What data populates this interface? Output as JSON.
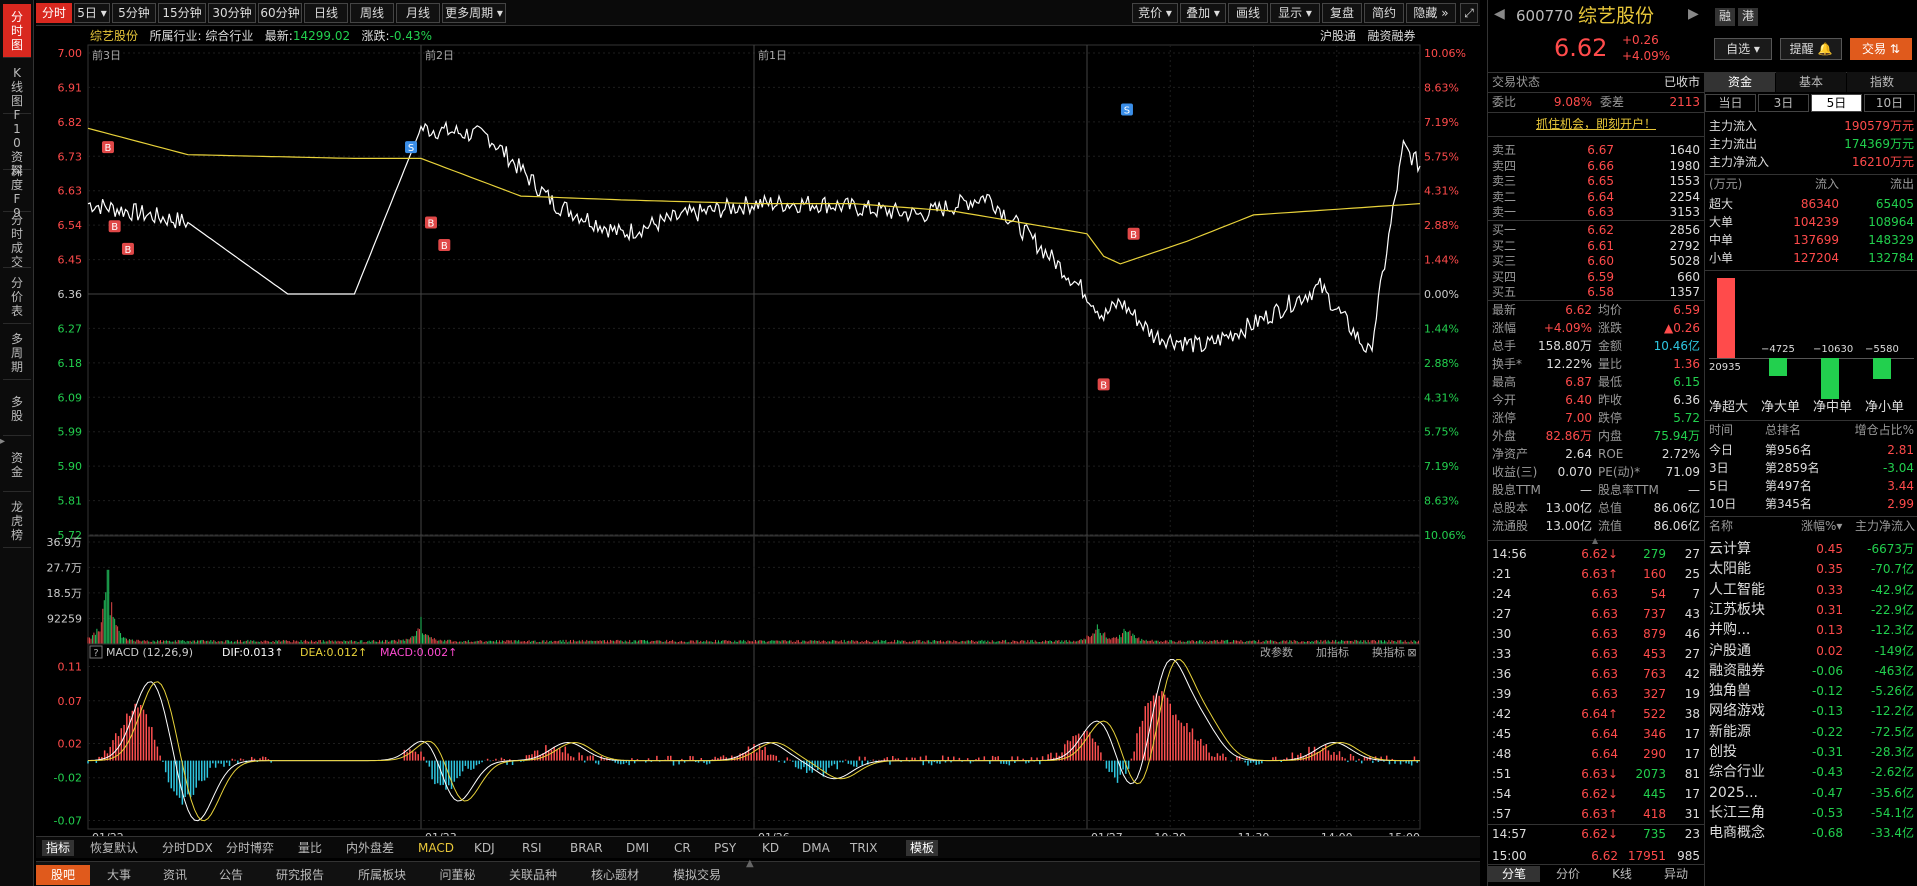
{
  "leftbar": [
    "分时图",
    "K线图",
    "F10资料",
    "深度F9",
    "分时成交",
    "分价表",
    "多周期",
    "多股",
    "资金",
    "龙虎榜"
  ],
  "topbar": {
    "periods": [
      "分时",
      "5日",
      "5分钟",
      "15分钟",
      "30分钟",
      "60分钟",
      "日线",
      "周线",
      "月线",
      "更多周期"
    ],
    "tools": [
      "竞价",
      "叠加",
      "画线",
      "显示",
      "复盘",
      "简约",
      "隐藏"
    ]
  },
  "infobar": {
    "name": "综艺股份",
    "industry": "所属行业: 综合行业",
    "latest_label": "最新:",
    "latest": "14299.02",
    "change_label": "涨跌:",
    "change": "-0.43%",
    "right": [
      "沪股通",
      "融资融券"
    ]
  },
  "chart_data": [
    {
      "type": "line",
      "title": "",
      "day_labels": [
        "前3日",
        "前2日",
        "前1日",
        ""
      ],
      "x_labels": [
        "01/22",
        "01/23",
        "01/26",
        "01/27",
        "10:30",
        "11:30",
        "14:00",
        "15:00"
      ],
      "ylim": [
        5.72,
        7.0
      ],
      "y_ticks_left": [
        "7.00",
        "6.91",
        "6.82",
        "6.73",
        "6.63",
        "6.54",
        "6.45",
        "6.36",
        "6.27",
        "6.18",
        "6.09",
        "5.99",
        "5.90",
        "5.81",
        "5.72"
      ],
      "y_ticks_right": [
        "10.06%",
        "8.63%",
        "7.19%",
        "5.75%",
        "4.31%",
        "2.88%",
        "1.44%",
        "0.00%",
        "1.44%",
        "2.88%",
        "4.31%",
        "5.75%",
        "7.19%",
        "8.63%",
        "10.06%"
      ],
      "series": [
        {
          "name": "",
          "color": "#ffffff",
          "x": [
            0,
            0.3,
            0.6,
            0.8,
            1.0,
            1.2,
            1.4,
            1.6,
            1.8,
            2.0,
            2.2,
            2.5,
            2.7,
            2.9,
            3.0,
            3.05,
            3.1,
            3.2,
            3.35,
            3.5,
            3.6,
            3.7,
            3.85,
            3.95,
            4.0
          ],
          "y": [
            6.6,
            6.55,
            6.36,
            6.36,
            6.8,
            6.78,
            6.6,
            6.52,
            6.57,
            6.6,
            6.6,
            6.57,
            6.62,
            6.45,
            6.36,
            6.3,
            6.34,
            6.25,
            6.22,
            6.28,
            6.33,
            6.38,
            6.2,
            6.75,
            6.7
          ]
        },
        {
          "name": "",
          "color": "#e8d23a",
          "x": [
            0,
            0.3,
            0.8,
            1.0,
            1.3,
            1.6,
            2.0,
            2.3,
            2.6,
            3.0,
            3.05,
            3.1,
            3.3,
            3.5,
            4.0
          ],
          "y": [
            6.8,
            6.73,
            6.72,
            6.72,
            6.62,
            6.61,
            6.6,
            6.6,
            6.58,
            6.52,
            6.46,
            6.44,
            6.5,
            6.57,
            6.6
          ]
        }
      ],
      "markers": [
        {
          "t": "B",
          "x": 0.06,
          "y": 6.75
        },
        {
          "t": "B",
          "x": 0.08,
          "y": 6.54
        },
        {
          "t": "B",
          "x": 0.12,
          "y": 6.48
        },
        {
          "t": "S",
          "x": 0.97,
          "y": 6.75
        },
        {
          "t": "B",
          "x": 1.03,
          "y": 6.55
        },
        {
          "t": "B",
          "x": 1.07,
          "y": 6.49
        },
        {
          "t": "B",
          "x": 3.05,
          "y": 6.12
        },
        {
          "t": "S",
          "x": 3.12,
          "y": 6.85
        },
        {
          "t": "B",
          "x": 3.14,
          "y": 6.52
        }
      ]
    },
    {
      "type": "bar",
      "title": "",
      "y_ticks": [
        "36.9万",
        "27.7万",
        "18.5万",
        "92259"
      ],
      "ylim": [
        0,
        369000
      ],
      "peaks": [
        {
          "x": 0.06,
          "v": 300000
        },
        {
          "x": 1.0,
          "v": 90000
        },
        {
          "x": 3.03,
          "v": 100000
        },
        {
          "x": 3.12,
          "v": 70000
        }
      ]
    },
    {
      "type": "bar",
      "title": "",
      "indicator": "MACD (12,26,9)",
      "dif_label": "DIF:0.013↑",
      "dea_label": "DEA:0.012↑",
      "macd_label": "MACD:0.002↑",
      "y_ticks": [
        "0.11",
        "0.07",
        "0.02",
        "-0.02",
        "-0.07"
      ],
      "ylim": [
        -0.08,
        0.12
      ],
      "buttons": [
        "改参数",
        "加指标",
        "换指标"
      ]
    }
  ],
  "bottom_indicators": [
    "指标",
    "恢复默认",
    "分时DDX",
    "分时博弈",
    "量比",
    "内外盘差",
    "MACD",
    "KDJ",
    "RSI",
    "BRAR",
    "DMI",
    "CR",
    "PSY",
    "KD",
    "DMA",
    "TRIX",
    "模板"
  ],
  "bottom_tabs": [
    "股吧",
    "大事",
    "资讯",
    "公告",
    "研究报告",
    "所属板块",
    "问董秘",
    "关联品种",
    "核心题材",
    "模拟交易"
  ],
  "stock": {
    "code": "600770",
    "name": "综艺股份",
    "price": "6.62",
    "change": "+0.26",
    "pct": "+4.09%",
    "tags": [
      "融",
      "港"
    ],
    "buttons": [
      "自选",
      "提醒",
      "交易"
    ]
  },
  "trade_status": {
    "label": "交易状态",
    "value": "已收市"
  },
  "weibi": {
    "wb_label": "委比",
    "wb": "9.08%",
    "wc_label": "委差",
    "wc": "2113"
  },
  "promo": "抓住机会，即刻开户！",
  "sells": [
    {
      "l": "卖五",
      "p": "6.67",
      "v": "1640"
    },
    {
      "l": "卖四",
      "p": "6.66",
      "v": "1980"
    },
    {
      "l": "卖三",
      "p": "6.65",
      "v": "1553"
    },
    {
      "l": "卖二",
      "p": "6.64",
      "v": "2254"
    },
    {
      "l": "卖一",
      "p": "6.63",
      "v": "3153"
    }
  ],
  "buys": [
    {
      "l": "买一",
      "p": "6.62",
      "v": "2856"
    },
    {
      "l": "买二",
      "p": "6.61",
      "v": "2792"
    },
    {
      "l": "买三",
      "p": "6.60",
      "v": "5028"
    },
    {
      "l": "买四",
      "p": "6.59",
      "v": "660"
    },
    {
      "l": "买五",
      "p": "6.58",
      "v": "1357"
    }
  ],
  "quote": [
    [
      "最新",
      "6.62",
      "均价",
      "6.59"
    ],
    [
      "涨幅",
      "+4.09%",
      "涨跌",
      "▲0.26"
    ],
    [
      "总手",
      "158.80万",
      "金额",
      "10.46亿"
    ],
    [
      "换手*",
      "12.22%",
      "量比",
      "1.36"
    ],
    [
      "最高",
      "6.87",
      "最低",
      "6.15"
    ],
    [
      "今开",
      "6.40",
      "昨收",
      "6.36"
    ],
    [
      "涨停",
      "7.00",
      "跌停",
      "5.72"
    ],
    [
      "外盘",
      "82.86万",
      "内盘",
      "75.94万"
    ],
    [
      "净资产",
      "2.64",
      "ROE",
      "2.72%"
    ],
    [
      "收益(三)",
      "0.070",
      "PE(动)*",
      "71.09"
    ],
    [
      "股息TTM",
      "—",
      "股息率TTM",
      "—"
    ],
    [
      "总股本",
      "13.00亿",
      "总值",
      "86.06亿"
    ],
    [
      "流通股",
      "13.00亿",
      "流值",
      "86.06亿"
    ]
  ],
  "ticks": [
    [
      "14:56",
      "6.62↓",
      "279",
      "27"
    ],
    [
      ":21",
      "6.63↑",
      "160",
      "25"
    ],
    [
      ":24",
      "6.63",
      "54",
      "7"
    ],
    [
      ":27",
      "6.63",
      "737",
      "43"
    ],
    [
      ":30",
      "6.63",
      "879",
      "46"
    ],
    [
      ":33",
      "6.63",
      "453",
      "27"
    ],
    [
      ":36",
      "6.63",
      "763",
      "42"
    ],
    [
      ":39",
      "6.63",
      "327",
      "19"
    ],
    [
      ":42",
      "6.64↑",
      "522",
      "38"
    ],
    [
      ":45",
      "6.64",
      "346",
      "17"
    ],
    [
      ":48",
      "6.64",
      "290",
      "17"
    ],
    [
      ":51",
      "6.63↓",
      "2073",
      "81"
    ],
    [
      ":54",
      "6.62↓",
      "445",
      "17"
    ],
    [
      ":57",
      "6.63↑",
      "418",
      "31"
    ],
    [
      "14:57",
      "6.62↓",
      "735",
      "23"
    ],
    [
      "15:00",
      "6.62",
      "17951",
      "985"
    ]
  ],
  "ticks_tabs": [
    "分笔",
    "分价",
    "K线",
    "异动"
  ],
  "fund_tabs": [
    "资金",
    "基本",
    "指数"
  ],
  "fund_period_tabs": [
    "当日",
    "3日",
    "5日",
    "10日"
  ],
  "fund_main": [
    [
      "主力流入",
      "190579万元"
    ],
    [
      "主力流出",
      "174369万元"
    ],
    [
      "主力净流入",
      "16210万元"
    ]
  ],
  "fund_header": [
    "(万元)",
    "流入",
    "流出"
  ],
  "fund_rows": [
    [
      "超大",
      "86340",
      "65405"
    ],
    [
      "大单",
      "104239",
      "108964"
    ],
    [
      "中单",
      "137699",
      "148329"
    ],
    [
      "小单",
      "127204",
      "132784"
    ]
  ],
  "fund_bars": [
    {
      "v": 20935,
      "lbl": "20935"
    },
    {
      "v": -4725,
      "lbl": "−4725"
    },
    {
      "v": -10630,
      "lbl": "−10630"
    },
    {
      "v": -5580,
      "lbl": "−5580"
    }
  ],
  "fund_bar_labels": [
    "净超大",
    "净大单",
    "净中单",
    "净小单"
  ],
  "rank_header": [
    "时间",
    "总排名",
    "增仓占比%"
  ],
  "ranks": [
    [
      "今日",
      "第956名",
      "2.81"
    ],
    [
      "3日",
      "第2859名",
      "-3.04"
    ],
    [
      "5日",
      "第497名",
      "3.44"
    ],
    [
      "10日",
      "第345名",
      "2.99"
    ]
  ],
  "sector_header": [
    "名称",
    "涨幅%",
    "主力净流入"
  ],
  "sectors": [
    [
      "云计算",
      "0.45",
      "-6673万"
    ],
    [
      "太阳能",
      "0.35",
      "-70.7亿"
    ],
    [
      "人工智能",
      "0.33",
      "-42.9亿"
    ],
    [
      "江苏板块",
      "0.31",
      "-22.9亿"
    ],
    [
      "并购...",
      "0.13",
      "-12.3亿"
    ],
    [
      "沪股通",
      "0.02",
      "-149亿"
    ],
    [
      "融资融券",
      "-0.06",
      "-463亿"
    ],
    [
      "独角兽",
      "-0.12",
      "-5.26亿"
    ],
    [
      "网络游戏",
      "-0.13",
      "-12.2亿"
    ],
    [
      "新能源",
      "-0.22",
      "-72.5亿"
    ],
    [
      "创投",
      "-0.31",
      "-28.3亿"
    ],
    [
      "综合行业",
      "-0.43",
      "-2.62亿"
    ],
    [
      "2025...",
      "-0.47",
      "-35.6亿"
    ],
    [
      "长江三角",
      "-0.53",
      "-54.1亿"
    ],
    [
      "电商概念",
      "-0.68",
      "-33.4亿"
    ]
  ]
}
